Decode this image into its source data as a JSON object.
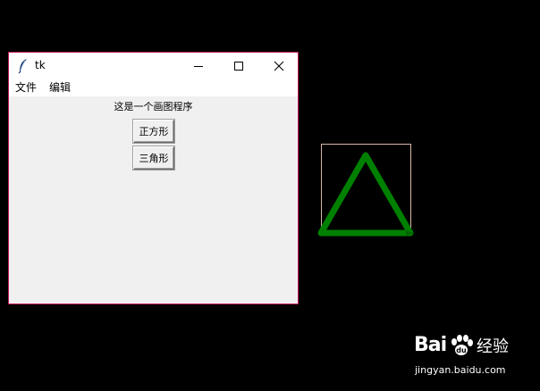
{
  "window": {
    "title": "tk",
    "icon": "feather-icon",
    "controls": [
      "minimize-icon",
      "maximize-icon",
      "close-icon"
    ]
  },
  "menu": {
    "file": "文件",
    "edit": "编辑"
  },
  "main": {
    "label": "这是一个画图程序",
    "square_button": "正方形",
    "triangle_button": "三角形"
  },
  "drawing": {
    "shape": "triangle",
    "stroke_color": "#008000",
    "frame_color": "#d9b8a8",
    "background": "#000000"
  },
  "watermark": {
    "brand": "Bai",
    "brand_suffix": "经验",
    "url": "jingyan.baidu.com"
  },
  "colors": {
    "window_border": "#c2185b",
    "window_bg": "#f0f0f0",
    "desktop_bg": "#000000"
  }
}
